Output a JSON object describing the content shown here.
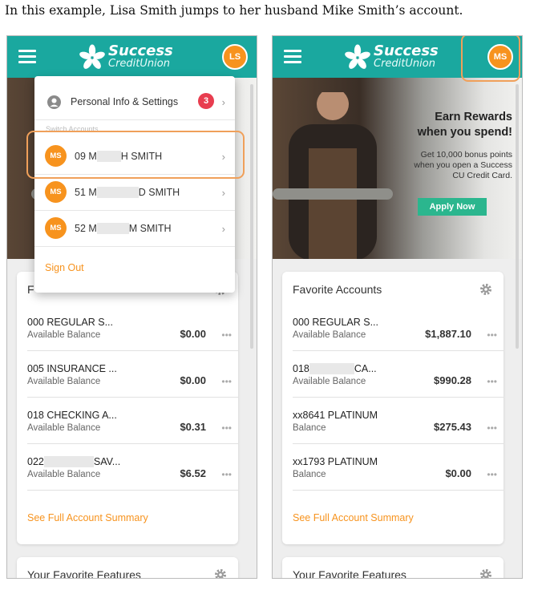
{
  "caption": "In this example, Lisa Smith jumps to her husband Mike Smith’s account.",
  "logo": {
    "title": "Success",
    "subtitle": "CreditUnion"
  },
  "colors": {
    "teal": "#1aa89f",
    "orange": "#f7931e",
    "badge_red": "#e83d4f",
    "apply_green": "#2bb68e",
    "highlight": "#f0a05a"
  },
  "left": {
    "avatar": "LS",
    "menu": {
      "settings_label": "Personal Info & Settings",
      "settings_badge": "3",
      "section_label": "Switch Accounts",
      "accounts": [
        {
          "avatar": "MS",
          "prefix": "09 M",
          "suffix": "H SMITH"
        },
        {
          "avatar": "MS",
          "prefix": "51 M",
          "suffix": "D SMITH"
        },
        {
          "avatar": "MS",
          "prefix": "52 M",
          "suffix": "M SMITH"
        }
      ],
      "sign_out": "Sign Out"
    },
    "panel_title_partial": "F",
    "accounts": [
      {
        "name": "000 REGULAR S...",
        "label": "Available Balance",
        "balance": "$0.00"
      },
      {
        "name": "005 INSURANCE ...",
        "label": "Available Balance",
        "balance": "$0.00"
      },
      {
        "name": "018 CHECKING A...",
        "label": "Available Balance",
        "balance": "$0.31"
      },
      {
        "name_prefix": "022",
        "name_suffix": "SAV...",
        "label": "Available Balance",
        "balance": "$6.52"
      }
    ],
    "see_full": "See Full Account Summary",
    "features_title": "Your Favorite Features"
  },
  "right": {
    "avatar": "MS",
    "promo": {
      "title_line1": "Earn Rewards",
      "title_line2": "when you spend!",
      "body_line1": "Get 10,000 bonus points",
      "body_line2": "when you open a Success",
      "body_line3": "CU Credit Card.",
      "button": "Apply Now"
    },
    "panel_title": "Favorite Accounts",
    "accounts": [
      {
        "name": "000 REGULAR S...",
        "label": "Available Balance",
        "balance": "$1,887.10"
      },
      {
        "name_prefix": "018",
        "name_suffix": "CA...",
        "label": "Available Balance",
        "balance": "$990.28"
      },
      {
        "name": "xx8641 PLATINUM",
        "label": "Balance",
        "balance": "$275.43"
      },
      {
        "name": "xx1793 PLATINUM",
        "label": "Balance",
        "balance": "$0.00"
      }
    ],
    "see_full": "See Full Account Summary",
    "features_title": "Your Favorite Features"
  }
}
